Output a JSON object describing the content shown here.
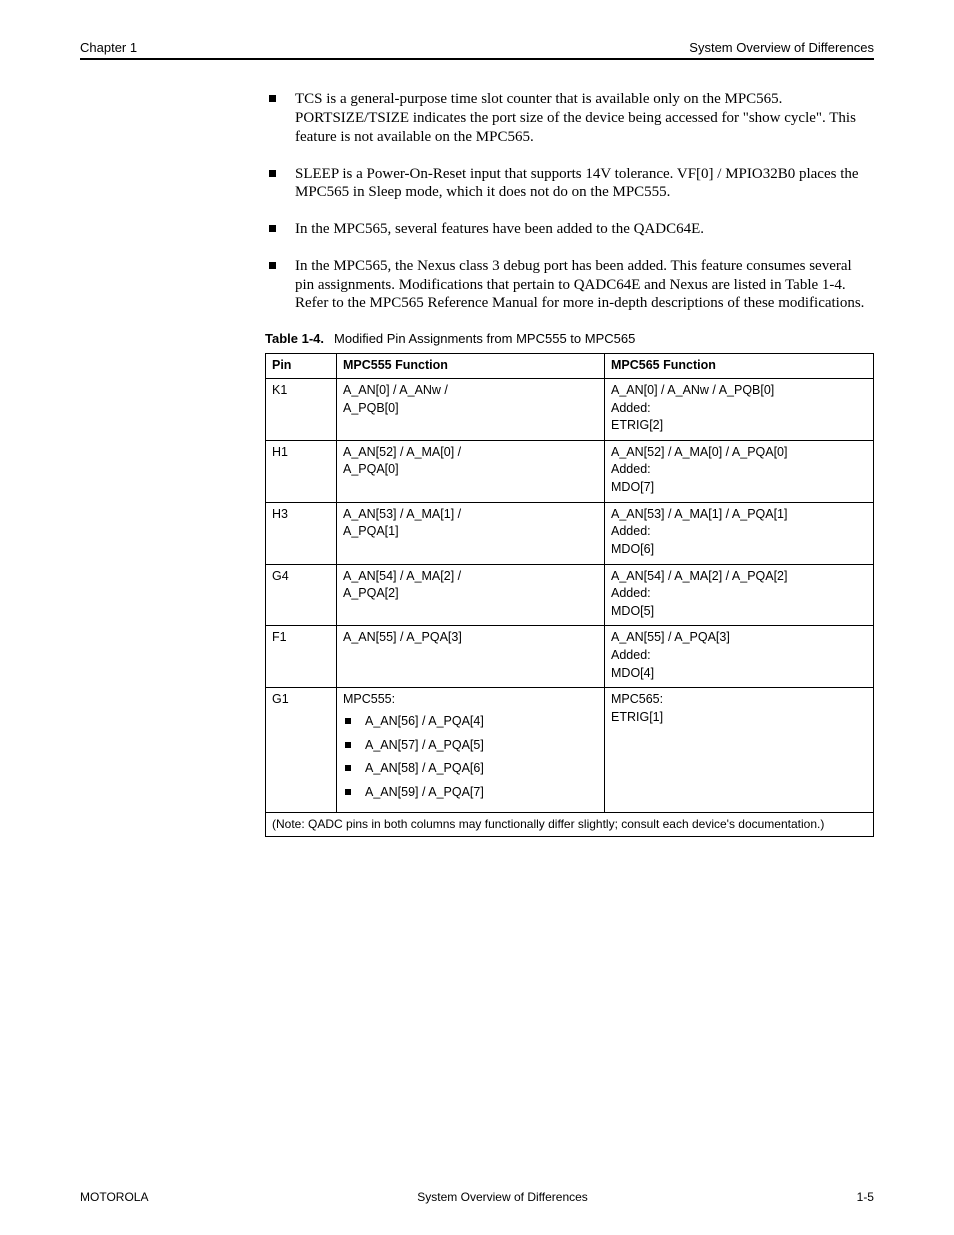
{
  "header": {
    "left": "Chapter 1",
    "right": "System Overview of Differences"
  },
  "bullets": [
    "TCS is a general-purpose time slot counter that is available only on the MPC565. PORTSIZE/TSIZE indicates the port size of the device being accessed for \"show cycle\". This feature is not available on the MPC565.",
    "SLEEP is a Power-On-Reset input that supports 14V tolerance. VF[0] / MPIO32B0 places the MPC565 in Sleep mode, which it does not do on the MPC555.",
    "In the MPC565, several features have been added to the QADC64E.",
    "In the MPC565, the Nexus class 3 debug port has been added. This feature consumes several pin assignments. Modifications that pertain to QADC64E and Nexus are listed in Table 1-4. Refer to the MPC565 Reference Manual for more in-depth descriptions of these modifications."
  ],
  "table": {
    "caption_num": "Table 1-4.",
    "caption_text": "Modified Pin Assignments from MPC555 to MPC565",
    "headers": [
      "Pin",
      "MPC555 Function",
      "MPC565 Function"
    ],
    "rows": [
      {
        "pin": "K1",
        "mpc555": [
          "A_AN[0] / A_ANw /",
          "A_PQB[0]"
        ],
        "mpc565": [
          "A_AN[0] / A_ANw / A_PQB[0]",
          "Added:",
          "ETRIG[2]"
        ]
      },
      {
        "pin": "H1",
        "mpc555": [
          "A_AN[52] / A_MA[0] /",
          "A_PQA[0]"
        ],
        "mpc565": [
          "A_AN[52] / A_MA[0] / A_PQA[0]",
          "Added:",
          "MDO[7]"
        ]
      },
      {
        "pin": "H3",
        "mpc555": [
          "A_AN[53] / A_MA[1] /",
          "A_PQA[1]"
        ],
        "mpc565": [
          "A_AN[53] / A_MA[1] / A_PQA[1]",
          "Added:",
          "MDO[6]"
        ]
      },
      {
        "pin": "G4",
        "mpc555": [
          "A_AN[54] / A_MA[2] /",
          "A_PQA[2]"
        ],
        "mpc565": [
          "A_AN[54] / A_MA[2] / A_PQA[2]",
          "Added:",
          "MDO[5]"
        ]
      },
      {
        "pin": "F1",
        "mpc555": [
          "A_AN[55] / A_PQA[3]"
        ],
        "mpc565": [
          "A_AN[55] / A_PQA[3]",
          "Added:",
          "MDO[4]"
        ]
      }
    ],
    "row_bullets": {
      "pin": "G1",
      "label": "MPC555:",
      "items": [
        "A_AN[56] / A_PQA[4]",
        "A_AN[57] / A_PQA[5]",
        "A_AN[58] / A_PQA[6]",
        "A_AN[59] / A_PQA[7]"
      ],
      "mpc565": [
        "MPC565:",
        "ETRIG[1]"
      ]
    },
    "footnote": "(Note: QADC pins in both columns may functionally differ slightly; consult each device's documentation.)"
  },
  "footer": {
    "left": "MOTOROLA",
    "center": "System Overview of Differences",
    "right": "1-5"
  }
}
